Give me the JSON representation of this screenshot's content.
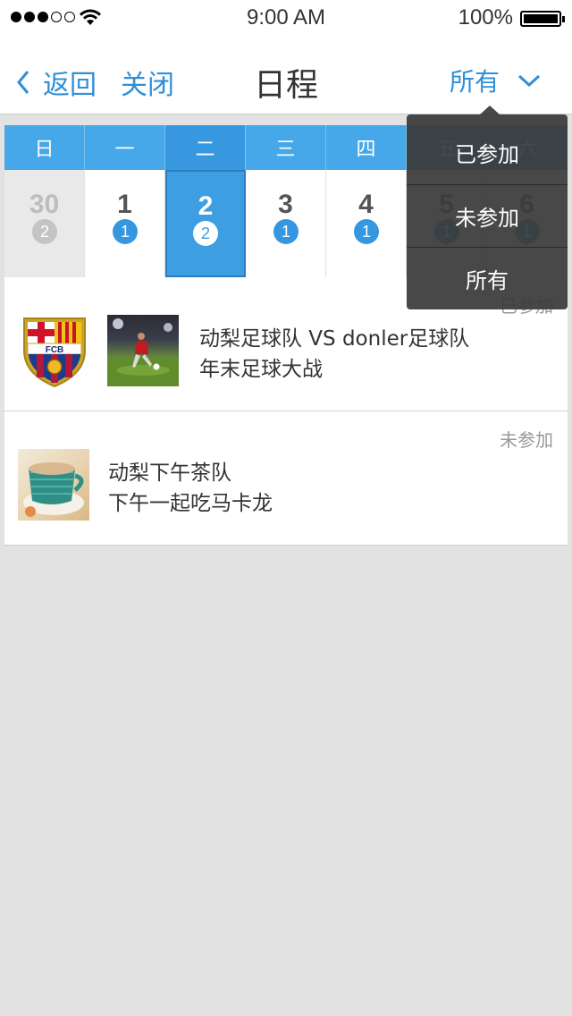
{
  "status_bar": {
    "time": "9:00 AM",
    "battery": "100%",
    "signal_bars": 3,
    "signal_total": 5
  },
  "nav": {
    "back_label": "返回",
    "close_label": "关闭",
    "title": "日程",
    "filter_label": "所有"
  },
  "calendar": {
    "weekdays": [
      "日",
      "一",
      "二",
      "三",
      "四",
      "五",
      "六"
    ],
    "selected_index": 2,
    "dates": [
      {
        "day": "30",
        "count": "2",
        "other_month": true
      },
      {
        "day": "1",
        "count": "1"
      },
      {
        "day": "2",
        "count": "2"
      },
      {
        "day": "3",
        "count": "1"
      },
      {
        "day": "4",
        "count": "1"
      },
      {
        "day": "5",
        "count": "1"
      },
      {
        "day": "6",
        "count": "1"
      }
    ]
  },
  "events": [
    {
      "status": "已参加",
      "title_line1": "动梨足球队 VS donler足球队",
      "title_line2": "年末足球大战",
      "crest_text": "FCB"
    },
    {
      "status": "未参加",
      "title_line1": "动梨下午茶队",
      "title_line2": "下午一起吃马卡龙"
    }
  ],
  "dropdown": {
    "items": [
      "已参加",
      "未参加",
      "所有"
    ]
  },
  "colors": {
    "accent": "#2f8fd8",
    "calendar_header": "#46a8e8",
    "selected_day": "#3d9fe2",
    "background": "#e2e2e2"
  }
}
